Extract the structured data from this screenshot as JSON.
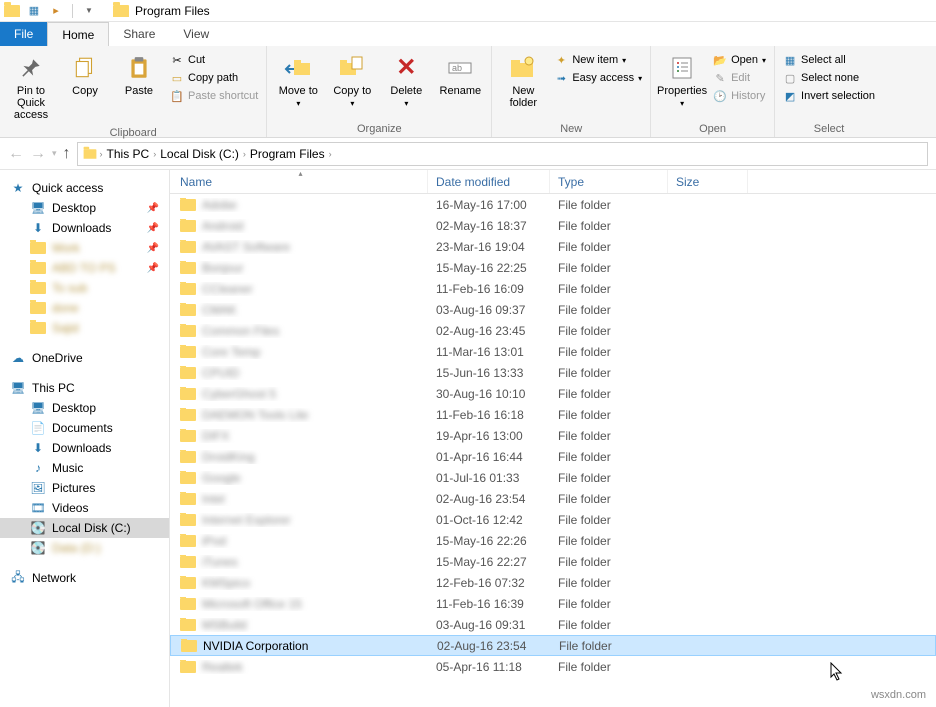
{
  "title": "Program Files",
  "tabs": {
    "file": "File",
    "home": "Home",
    "share": "Share",
    "view": "View"
  },
  "ribbon": {
    "clipboard": {
      "label": "Clipboard",
      "pin": "Pin to Quick access",
      "copy": "Copy",
      "paste": "Paste",
      "cut": "Cut",
      "copypath": "Copy path",
      "pasteshortcut": "Paste shortcut"
    },
    "organize": {
      "label": "Organize",
      "moveto": "Move to",
      "copyto": "Copy to",
      "delete": "Delete",
      "rename": "Rename"
    },
    "new_": {
      "label": "New",
      "newfolder": "New folder",
      "newitem": "New item",
      "easyaccess": "Easy access"
    },
    "open": {
      "label": "Open",
      "properties": "Properties",
      "open": "Open",
      "edit": "Edit",
      "history": "History"
    },
    "select": {
      "label": "Select",
      "all": "Select all",
      "none": "Select none",
      "invert": "Invert selection"
    }
  },
  "breadcrumb": [
    "This PC",
    "Local Disk (C:)",
    "Program Files"
  ],
  "columns": {
    "name": "Name",
    "date": "Date modified",
    "type": "Type",
    "size": "Size"
  },
  "sidebar": {
    "quick": "Quick access",
    "desktop": "Desktop",
    "downloads": "Downloads",
    "onedrive": "OneDrive",
    "thispc": "This PC",
    "tp_desktop": "Desktop",
    "tp_documents": "Documents",
    "tp_downloads": "Downloads",
    "tp_music": "Music",
    "tp_pictures": "Pictures",
    "tp_videos": "Videos",
    "tp_localdisk": "Local Disk (C:)",
    "network": "Network"
  },
  "rows": [
    {
      "name": "Adobe",
      "date": "16-May-16 17:00",
      "type": "File folder",
      "blur": true
    },
    {
      "name": "Android",
      "date": "02-May-16 18:37",
      "type": "File folder",
      "blur": true
    },
    {
      "name": "AVAST Software",
      "date": "23-Mar-16 19:04",
      "type": "File folder",
      "blur": true
    },
    {
      "name": "Bonjour",
      "date": "15-May-16 22:25",
      "type": "File folder",
      "blur": true
    },
    {
      "name": "CCleaner",
      "date": "11-Feb-16 16:09",
      "type": "File folder",
      "blur": true
    },
    {
      "name": "CMAK",
      "date": "03-Aug-16 09:37",
      "type": "File folder",
      "blur": true
    },
    {
      "name": "Common Files",
      "date": "02-Aug-16 23:45",
      "type": "File folder",
      "blur": true
    },
    {
      "name": "Core Temp",
      "date": "11-Mar-16 13:01",
      "type": "File folder",
      "blur": true
    },
    {
      "name": "CPUID",
      "date": "15-Jun-16 13:33",
      "type": "File folder",
      "blur": true
    },
    {
      "name": "CyberGhost 5",
      "date": "30-Aug-16 10:10",
      "type": "File folder",
      "blur": true
    },
    {
      "name": "DAEMON Tools Lite",
      "date": "11-Feb-16 16:18",
      "type": "File folder",
      "blur": true
    },
    {
      "name": "DIFX",
      "date": "19-Apr-16 13:00",
      "type": "File folder",
      "blur": true
    },
    {
      "name": "DroidKing",
      "date": "01-Apr-16 16:44",
      "type": "File folder",
      "blur": true
    },
    {
      "name": "Google",
      "date": "01-Jul-16 01:33",
      "type": "File folder",
      "blur": true
    },
    {
      "name": "Intel",
      "date": "02-Aug-16 23:54",
      "type": "File folder",
      "blur": true
    },
    {
      "name": "Internet Explorer",
      "date": "01-Oct-16 12:42",
      "type": "File folder",
      "blur": true
    },
    {
      "name": "iPod",
      "date": "15-May-16 22:26",
      "type": "File folder",
      "blur": true
    },
    {
      "name": "iTunes",
      "date": "15-May-16 22:27",
      "type": "File folder",
      "blur": true
    },
    {
      "name": "KMSpico",
      "date": "12-Feb-16 07:32",
      "type": "File folder",
      "blur": true
    },
    {
      "name": "Microsoft Office 15",
      "date": "11-Feb-16 16:39",
      "type": "File folder",
      "blur": true
    },
    {
      "name": "MSBuild",
      "date": "03-Aug-16 09:31",
      "type": "File folder",
      "blur": true
    },
    {
      "name": "NVIDIA Corporation",
      "date": "02-Aug-16 23:54",
      "type": "File folder",
      "blur": false,
      "sel": true
    },
    {
      "name": "Realtek",
      "date": "05-Apr-16 11:18",
      "type": "File folder",
      "blur": true
    }
  ],
  "watermark": "wsxdn.com"
}
